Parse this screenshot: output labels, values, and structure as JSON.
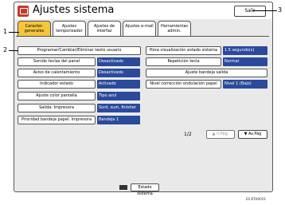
{
  "window": {
    "title": "Ajustes sistema",
    "exit_label": "Salir"
  },
  "tabs": [
    {
      "label": "Caracter. generales",
      "active": true
    },
    {
      "label": "Ajustes temporizador",
      "active": false
    },
    {
      "label": "Ajustes de interfaz",
      "active": false
    },
    {
      "label": "Ajustes e-mail",
      "active": false
    },
    {
      "label": "Herramientas admin.",
      "active": false
    }
  ],
  "left_settings": [
    {
      "label": "Programar/Cambiar/Eliminar texto usuario",
      "value": null
    },
    {
      "label": "Sonido teclas del panel",
      "value": "Desactivado"
    },
    {
      "label": "Aviso de calentamiento",
      "value": "Desactivado"
    },
    {
      "label": "Indicador estado",
      "value": "Activado"
    },
    {
      "label": "Ajuste color pantalla",
      "value": "Tipo azul"
    },
    {
      "label": "Salida: Impresora",
      "value": "Sord, sum, finisher"
    },
    {
      "label": "Prioridad bandeja papel: Impresora",
      "value": "Bandeja 1"
    }
  ],
  "right_settings": [
    {
      "label": "Hora visualización estado sistema",
      "value": "1.5 segundo(s)"
    },
    {
      "label": "Repetición tecla",
      "value": "Normal"
    },
    {
      "label": "Ajuste bandeja salida",
      "value": null
    },
    {
      "label": "Nivel corrección ondulación papel",
      "value": "Nivel 1 (Bajo)"
    }
  ],
  "pager": {
    "indicator": "1/2",
    "prev_label": "▲ Ir.Pág.",
    "next_label": "▼ Av.Pág"
  },
  "status_bar": {
    "button_label": "Estado sistema"
  },
  "callouts": {
    "c1": "1",
    "c2": "2",
    "c3": "3"
  },
  "reference_code": "ES BTH001S",
  "colors": {
    "active_tab": "#f5c63c",
    "value_field": "#2b4a9c",
    "app_icon": "#c23a2b"
  }
}
